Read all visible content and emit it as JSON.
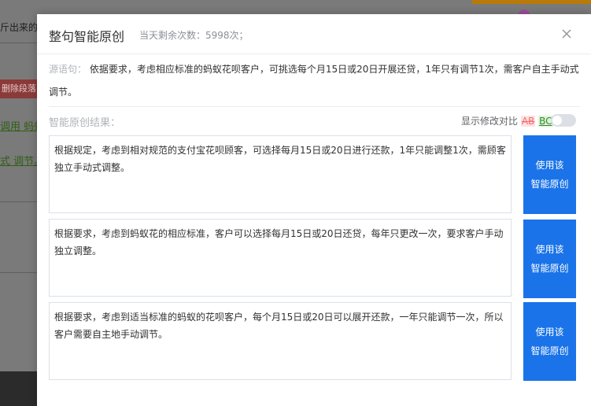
{
  "background": {
    "snippet_text": "斤出来的",
    "delete_paragraph_label": "删除段落",
    "green_line_1": "调用 蚂蚁",
    "green_line_2": "式 调节。"
  },
  "modal": {
    "title": "整句智能原创",
    "quota_text": "当天剩余次数：5998次；",
    "close_icon": "close-icon",
    "source_label": "源语句：",
    "source_text": "依据要求，考虑相应标准的蚂蚁花呗客户，可挑选每个月15日或20日开展还贷，1年只有调节1次，需客户自主手动式调节。",
    "result_label": "智能原创结果：",
    "compare_label": "显示修改对比",
    "compare_deleted_sample": "AB",
    "compare_added_sample": "BC",
    "compare_toggle_on": false,
    "results": [
      {
        "text": "根据规定，考虑到相对规范的支付宝花呗顾客，可选择每月15日或20日进行还款，1年只能调整1次，需顾客独立手动式调整。",
        "button": "使用该 智能原创"
      },
      {
        "text": "根据要求，考虑到蚂蚁花的相应标准，客户可以选择每月15日或20日还贷，每年只更改一次，要求客户手动独立调整。",
        "button": "使用该 智能原创"
      },
      {
        "text": "根据要求，考虑到适当标准的蚂蚁的花呗客户，每个月15日或20日可以展开还款，一年只能调节一次，所以客户需要自主地手动调节。",
        "button": "使用该 智能原创"
      }
    ],
    "button_line1": "使用该",
    "button_line2": "智能原创"
  },
  "colors": {
    "primary_button": "#1a73e8",
    "overlay": "#7a7a7a",
    "diff_deleted": "#f56c6c",
    "diff_added": "#2e8b2e"
  }
}
